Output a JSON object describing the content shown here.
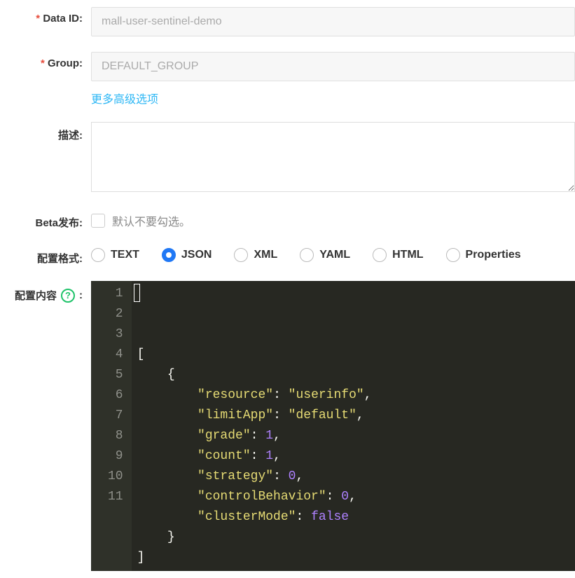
{
  "form": {
    "dataId": {
      "label": "Data ID:",
      "value": "mall-user-sentinel-demo"
    },
    "group": {
      "label": "Group:",
      "value": "DEFAULT_GROUP"
    },
    "advanced": "更多高级选项",
    "desc": {
      "label": "描述:",
      "value": ""
    },
    "beta": {
      "label": "Beta发布:",
      "hint": "默认不要勾选。",
      "checked": false
    },
    "format": {
      "label": "配置格式:",
      "options": [
        "TEXT",
        "JSON",
        "XML",
        "YAML",
        "HTML",
        "Properties"
      ],
      "selected": "JSON"
    },
    "content": {
      "label_prefix": "配置内容",
      "label_suffix": ":",
      "help": "?",
      "lines": [
        [
          {
            "t": "punc",
            "v": "["
          }
        ],
        [
          {
            "t": "punc",
            "v": "    {"
          }
        ],
        [
          {
            "t": "punc",
            "v": "        "
          },
          {
            "t": "key",
            "v": "\"resource\""
          },
          {
            "t": "col",
            "v": ": "
          },
          {
            "t": "str",
            "v": "\"userinfo\""
          },
          {
            "t": "punc",
            "v": ","
          }
        ],
        [
          {
            "t": "punc",
            "v": "        "
          },
          {
            "t": "key",
            "v": "\"limitApp\""
          },
          {
            "t": "col",
            "v": ": "
          },
          {
            "t": "str",
            "v": "\"default\""
          },
          {
            "t": "punc",
            "v": ","
          }
        ],
        [
          {
            "t": "punc",
            "v": "        "
          },
          {
            "t": "key",
            "v": "\"grade\""
          },
          {
            "t": "col",
            "v": ": "
          },
          {
            "t": "num",
            "v": "1"
          },
          {
            "t": "punc",
            "v": ","
          }
        ],
        [
          {
            "t": "punc",
            "v": "        "
          },
          {
            "t": "key",
            "v": "\"count\""
          },
          {
            "t": "col",
            "v": ": "
          },
          {
            "t": "num",
            "v": "1"
          },
          {
            "t": "punc",
            "v": ","
          }
        ],
        [
          {
            "t": "punc",
            "v": "        "
          },
          {
            "t": "key",
            "v": "\"strategy\""
          },
          {
            "t": "col",
            "v": ": "
          },
          {
            "t": "num",
            "v": "0"
          },
          {
            "t": "punc",
            "v": ","
          }
        ],
        [
          {
            "t": "punc",
            "v": "        "
          },
          {
            "t": "key",
            "v": "\"controlBehavior\""
          },
          {
            "t": "col",
            "v": ": "
          },
          {
            "t": "num",
            "v": "0"
          },
          {
            "t": "punc",
            "v": ","
          }
        ],
        [
          {
            "t": "punc",
            "v": "        "
          },
          {
            "t": "key",
            "v": "\"clusterMode\""
          },
          {
            "t": "col",
            "v": ": "
          },
          {
            "t": "bool",
            "v": "false"
          }
        ],
        [
          {
            "t": "punc",
            "v": "    }"
          }
        ],
        [
          {
            "t": "punc",
            "v": "]"
          }
        ]
      ]
    }
  }
}
